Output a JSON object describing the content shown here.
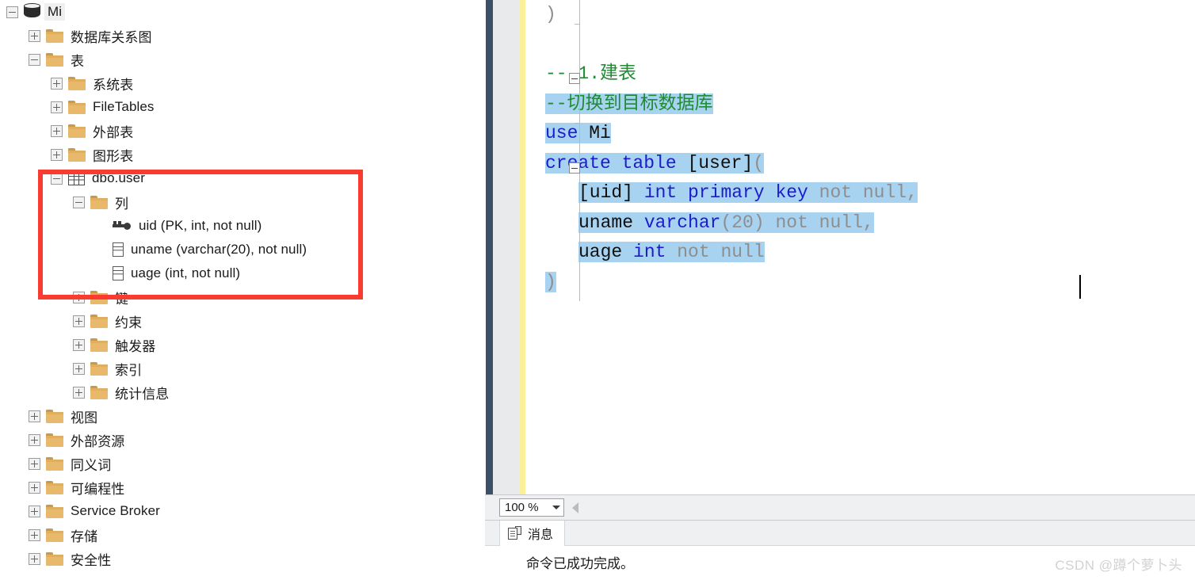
{
  "object_explorer": {
    "nodes": [
      {
        "label": "Mi",
        "icon": "database-icon",
        "indent": 0,
        "expander": "minus",
        "selected": true
      },
      {
        "label": "数据库关系图",
        "icon": "folder-icon",
        "indent": 1,
        "expander": "plus",
        "selected": false
      },
      {
        "label": "表",
        "icon": "folder-icon",
        "indent": 1,
        "expander": "minus",
        "selected": false
      },
      {
        "label": "系统表",
        "icon": "folder-icon",
        "indent": 2,
        "expander": "plus",
        "selected": false
      },
      {
        "label": "FileTables",
        "icon": "folder-icon",
        "indent": 2,
        "expander": "plus",
        "selected": false
      },
      {
        "label": "外部表",
        "icon": "folder-icon",
        "indent": 2,
        "expander": "plus",
        "selected": false
      },
      {
        "label": "图形表",
        "icon": "folder-icon",
        "indent": 2,
        "expander": "plus",
        "selected": false
      },
      {
        "label": "dbo.user",
        "icon": "table-icon",
        "indent": 2,
        "expander": "minus",
        "selected": false
      },
      {
        "label": "列",
        "icon": "folder-icon",
        "indent": 3,
        "expander": "minus",
        "selected": false
      },
      {
        "label": "uid (PK, int, not null)",
        "icon": "key-icon",
        "indent": 4,
        "expander": "none",
        "selected": false
      },
      {
        "label": "uname (varchar(20), not null)",
        "icon": "column-icon",
        "indent": 4,
        "expander": "none",
        "selected": false
      },
      {
        "label": "uage (int, not null)",
        "icon": "column-icon",
        "indent": 4,
        "expander": "none",
        "selected": false
      },
      {
        "label": "键",
        "icon": "folder-icon",
        "indent": 3,
        "expander": "plus",
        "selected": false
      },
      {
        "label": "约束",
        "icon": "folder-icon",
        "indent": 3,
        "expander": "plus",
        "selected": false
      },
      {
        "label": "触发器",
        "icon": "folder-icon",
        "indent": 3,
        "expander": "plus",
        "selected": false
      },
      {
        "label": "索引",
        "icon": "folder-icon",
        "indent": 3,
        "expander": "plus",
        "selected": false
      },
      {
        "label": "统计信息",
        "icon": "folder-icon",
        "indent": 3,
        "expander": "plus",
        "selected": false
      },
      {
        "label": "视图",
        "icon": "folder-icon",
        "indent": 1,
        "expander": "plus",
        "selected": false
      },
      {
        "label": "外部资源",
        "icon": "folder-icon",
        "indent": 1,
        "expander": "plus",
        "selected": false
      },
      {
        "label": "同义词",
        "icon": "folder-icon",
        "indent": 1,
        "expander": "plus",
        "selected": false
      },
      {
        "label": "可编程性",
        "icon": "folder-icon",
        "indent": 1,
        "expander": "plus",
        "selected": false
      },
      {
        "label": "Service Broker",
        "icon": "folder-icon",
        "indent": 1,
        "expander": "plus",
        "selected": false
      },
      {
        "label": "存储",
        "icon": "folder-icon",
        "indent": 1,
        "expander": "plus",
        "selected": false
      },
      {
        "label": "安全性",
        "icon": "folder-icon",
        "indent": 1,
        "expander": "plus",
        "selected": false
      }
    ],
    "highlight_color": "#fa3b32"
  },
  "editor": {
    "lines": [
      {
        "indent": 0,
        "segments": [
          {
            "text": ")",
            "type": "paren",
            "hl": false
          }
        ]
      },
      {
        "indent": 0,
        "segments": []
      },
      {
        "indent": 0,
        "segments": [
          {
            "text": "-- 1.建表",
            "type": "comment",
            "hl": false
          }
        ]
      },
      {
        "indent": 0,
        "segments": [
          {
            "text": "--切换到目标数据库",
            "type": "comment",
            "hl": true
          }
        ]
      },
      {
        "indent": 0,
        "segments": [
          {
            "text": "use ",
            "type": "keyword",
            "hl": true
          },
          {
            "text": "Mi",
            "type": "plain",
            "hl": true
          }
        ]
      },
      {
        "indent": 0,
        "segments": [
          {
            "text": "create table ",
            "type": "keyword",
            "hl": true
          },
          {
            "text": "[user]",
            "type": "plain",
            "hl": true
          },
          {
            "text": "(",
            "type": "paren",
            "hl": true
          }
        ]
      },
      {
        "indent": 1,
        "segments": [
          {
            "text": "[uid] ",
            "type": "plain",
            "hl": true
          },
          {
            "text": "int primary key ",
            "type": "keyword",
            "hl": true
          },
          {
            "text": "not null,",
            "type": "gray",
            "hl": true
          }
        ]
      },
      {
        "indent": 1,
        "segments": [
          {
            "text": "uname ",
            "type": "plain",
            "hl": true
          },
          {
            "text": "varchar",
            "type": "keyword",
            "hl": true
          },
          {
            "text": "(20)",
            "type": "paren",
            "hl": true
          },
          {
            "text": " not null,",
            "type": "gray",
            "hl": true
          }
        ]
      },
      {
        "indent": 1,
        "segments": [
          {
            "text": "uage ",
            "type": "plain",
            "hl": true
          },
          {
            "text": "int",
            "type": "keyword",
            "hl": true
          },
          {
            "text": " not null",
            "type": "gray",
            "hl": true
          }
        ]
      },
      {
        "indent": 0,
        "segments": [
          {
            "text": ")",
            "type": "paren",
            "hl": true
          }
        ]
      }
    ],
    "colors": {
      "keyword": "#1c1ccc",
      "comment": "#1f8b33",
      "plain": "#101010",
      "gray": "#8e8e8e",
      "selection": "#a7d2f0",
      "change_bar": "#fbf09a"
    }
  },
  "zoom_bar": {
    "zoom_value": "100 %",
    "dropdown_icon": "chevron-down-icon",
    "scroll_left_icon": "triangle-left-icon"
  },
  "results": {
    "tab_label": "消息",
    "tab_icon": "messages-icon",
    "message": "命令已成功完成。"
  },
  "watermark": {
    "text": "CSDN @蹲个萝卜头"
  }
}
